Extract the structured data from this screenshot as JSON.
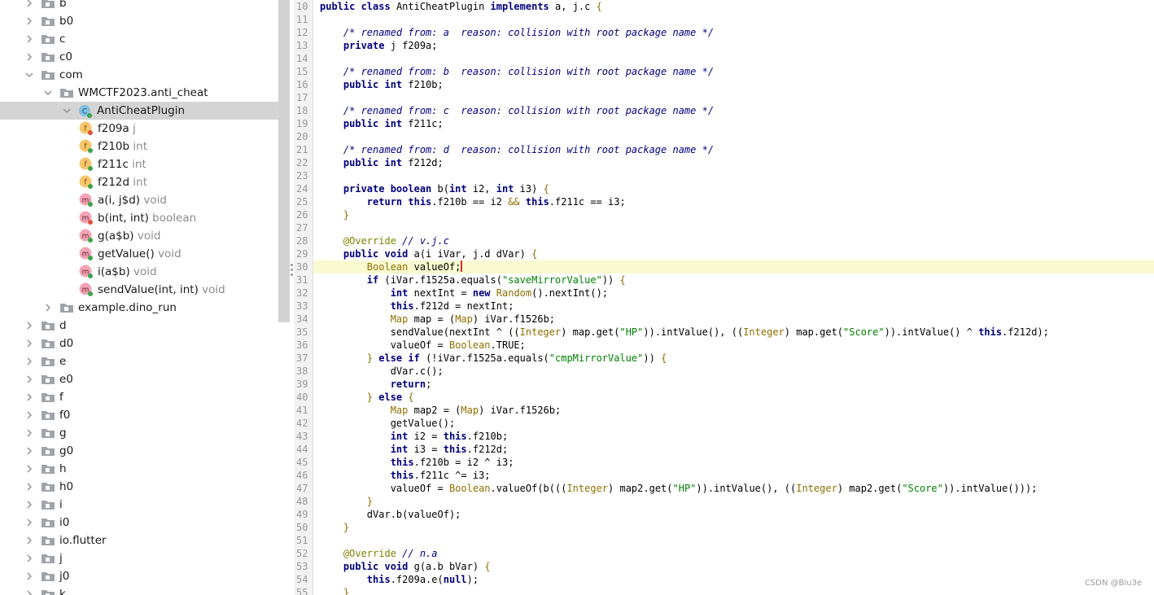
{
  "tree": {
    "rows": [
      {
        "label": "b",
        "type": "",
        "kind": "package",
        "expanded": false,
        "depth": 0
      },
      {
        "label": "b0",
        "type": "",
        "kind": "package",
        "expanded": false,
        "depth": 0
      },
      {
        "label": "c",
        "type": "",
        "kind": "package",
        "expanded": false,
        "depth": 0
      },
      {
        "label": "c0",
        "type": "",
        "kind": "package",
        "expanded": false,
        "depth": 0
      },
      {
        "label": "com",
        "type": "",
        "kind": "package",
        "expanded": true,
        "depth": 0
      },
      {
        "label": "WMCTF2023.anti_cheat",
        "type": "",
        "kind": "package",
        "expanded": true,
        "depth": 1
      },
      {
        "label": "AntiCheatPlugin",
        "type": "",
        "kind": "class",
        "expanded": true,
        "depth": 2,
        "selected": true
      },
      {
        "label": "f209a",
        "type": "j",
        "kind": "field-private",
        "depth": 3
      },
      {
        "label": "f210b",
        "type": "int",
        "kind": "field-public",
        "depth": 3
      },
      {
        "label": "f211c",
        "type": "int",
        "kind": "field-public",
        "depth": 3
      },
      {
        "label": "f212d",
        "type": "int",
        "kind": "field-public",
        "depth": 3
      },
      {
        "label": "a(i, j$d)",
        "type": "void",
        "kind": "method-public",
        "depth": 3
      },
      {
        "label": "b(int, int)",
        "type": "boolean",
        "kind": "method-private",
        "depth": 3
      },
      {
        "label": "g(a$b)",
        "type": "void",
        "kind": "method-public",
        "depth": 3
      },
      {
        "label": "getValue()",
        "type": "void",
        "kind": "method-public-native",
        "depth": 3
      },
      {
        "label": "i(a$b)",
        "type": "void",
        "kind": "method-public",
        "depth": 3
      },
      {
        "label": "sendValue(int, int)",
        "type": "void",
        "kind": "method-public-native",
        "depth": 3
      },
      {
        "label": "example.dino_run",
        "type": "",
        "kind": "package",
        "expanded": false,
        "depth": 1
      },
      {
        "label": "d",
        "type": "",
        "kind": "package",
        "expanded": false,
        "depth": 0
      },
      {
        "label": "d0",
        "type": "",
        "kind": "package",
        "expanded": false,
        "depth": 0
      },
      {
        "label": "e",
        "type": "",
        "kind": "package",
        "expanded": false,
        "depth": 0
      },
      {
        "label": "e0",
        "type": "",
        "kind": "package",
        "expanded": false,
        "depth": 0
      },
      {
        "label": "f",
        "type": "",
        "kind": "package",
        "expanded": false,
        "depth": 0
      },
      {
        "label": "f0",
        "type": "",
        "kind": "package",
        "expanded": false,
        "depth": 0
      },
      {
        "label": "g",
        "type": "",
        "kind": "package",
        "expanded": false,
        "depth": 0
      },
      {
        "label": "g0",
        "type": "",
        "kind": "package",
        "expanded": false,
        "depth": 0
      },
      {
        "label": "h",
        "type": "",
        "kind": "package",
        "expanded": false,
        "depth": 0
      },
      {
        "label": "h0",
        "type": "",
        "kind": "package",
        "expanded": false,
        "depth": 0
      },
      {
        "label": "i",
        "type": "",
        "kind": "package",
        "expanded": false,
        "depth": 0
      },
      {
        "label": "i0",
        "type": "",
        "kind": "package",
        "expanded": false,
        "depth": 0
      },
      {
        "label": "io.flutter",
        "type": "",
        "kind": "package",
        "expanded": false,
        "depth": 0
      },
      {
        "label": "j",
        "type": "",
        "kind": "package",
        "expanded": false,
        "depth": 0
      },
      {
        "label": "j0",
        "type": "",
        "kind": "package",
        "expanded": false,
        "depth": 0
      },
      {
        "label": "k",
        "type": "",
        "kind": "package",
        "expanded": false,
        "depth": 0
      }
    ]
  },
  "editor": {
    "current_line": 30,
    "lines": [
      {
        "n": "10",
        "tokens": [
          [
            "kw",
            "public "
          ],
          [
            "kw",
            "class "
          ],
          [
            "",
            "AntiCheatPlugin "
          ],
          [
            "kw",
            "implements "
          ],
          [
            "",
            "a, j.c "
          ],
          [
            "ty",
            "{"
          ]
        ]
      },
      {
        "n": "11",
        "tokens": []
      },
      {
        "n": "12",
        "tokens": [
          [
            "",
            "    "
          ],
          [
            "cm",
            "/* renamed from: a  reason: collision with root package name */"
          ]
        ]
      },
      {
        "n": "13",
        "tokens": [
          [
            "",
            "    "
          ],
          [
            "kw",
            "private "
          ],
          [
            "",
            "j f209a;"
          ]
        ]
      },
      {
        "n": "14",
        "tokens": []
      },
      {
        "n": "15",
        "tokens": [
          [
            "",
            "    "
          ],
          [
            "cm",
            "/* renamed from: b  reason: collision with root package name */"
          ]
        ]
      },
      {
        "n": "16",
        "tokens": [
          [
            "",
            "    "
          ],
          [
            "kw",
            "public "
          ],
          [
            "kw",
            "int "
          ],
          [
            "",
            "f210b;"
          ]
        ]
      },
      {
        "n": "17",
        "tokens": []
      },
      {
        "n": "18",
        "tokens": [
          [
            "",
            "    "
          ],
          [
            "cm",
            "/* renamed from: c  reason: collision with root package name */"
          ]
        ]
      },
      {
        "n": "19",
        "tokens": [
          [
            "",
            "    "
          ],
          [
            "kw",
            "public "
          ],
          [
            "kw",
            "int "
          ],
          [
            "",
            "f211c;"
          ]
        ]
      },
      {
        "n": "20",
        "tokens": []
      },
      {
        "n": "21",
        "tokens": [
          [
            "",
            "    "
          ],
          [
            "cm",
            "/* renamed from: d  reason: collision with root package name */"
          ]
        ]
      },
      {
        "n": "22",
        "tokens": [
          [
            "",
            "    "
          ],
          [
            "kw",
            "public "
          ],
          [
            "kw",
            "int "
          ],
          [
            "",
            "f212d;"
          ]
        ]
      },
      {
        "n": "23",
        "tokens": []
      },
      {
        "n": "24",
        "tokens": [
          [
            "",
            "    "
          ],
          [
            "kw",
            "private "
          ],
          [
            "kw",
            "boolean "
          ],
          [
            "",
            "b("
          ],
          [
            "kw",
            "int "
          ],
          [
            "",
            "i2, "
          ],
          [
            "kw",
            "int "
          ],
          [
            "",
            "i3) "
          ],
          [
            "ty",
            "{"
          ]
        ]
      },
      {
        "n": "25",
        "tokens": [
          [
            "",
            "        "
          ],
          [
            "kw",
            "return "
          ],
          [
            "kw",
            "this"
          ],
          [
            ".f210b == i2 "
          ],
          [
            "ty",
            "&&"
          ],
          [
            "",
            " "
          ],
          [
            "kw",
            "this"
          ],
          [
            "",
            ".f211c == i3;"
          ]
        ]
      },
      {
        "n": "26",
        "tokens": [
          [
            "",
            "    "
          ],
          [
            "ty",
            "}"
          ]
        ]
      },
      {
        "n": "27",
        "tokens": []
      },
      {
        "n": "28",
        "tokens": [
          [
            "",
            "    "
          ],
          [
            "an",
            "@Override "
          ],
          [
            "cm",
            "// v.j.c"
          ]
        ]
      },
      {
        "n": "29",
        "tokens": [
          [
            "",
            "    "
          ],
          [
            "kw",
            "public "
          ],
          [
            "kw",
            "void "
          ],
          [
            "",
            "a(i iVar, j.d dVar) "
          ],
          [
            "ty",
            "{"
          ]
        ]
      },
      {
        "n": "30",
        "tokens": [
          [
            "",
            "        "
          ],
          [
            "ty",
            "Boolean "
          ],
          [
            "",
            "valueOf;"
          ],
          [
            "caret",
            ""
          ]
        ]
      },
      {
        "n": "31",
        "tokens": [
          [
            "",
            "        "
          ],
          [
            "kw",
            "if "
          ],
          [
            "",
            "(iVar.f1525a.equals("
          ],
          [
            "st",
            "\"saveMirrorValue\""
          ],
          [
            "",
            "))"
          ],
          [
            "",
            " "
          ],
          [
            "ty",
            "{"
          ]
        ]
      },
      {
        "n": "32",
        "tokens": [
          [
            "",
            "            "
          ],
          [
            "kw",
            "int "
          ],
          [
            "",
            "nextInt = "
          ],
          [
            "kw",
            "new "
          ],
          [
            "ty",
            "Random"
          ],
          [
            "",
            "().nextInt();"
          ]
        ]
      },
      {
        "n": "33",
        "tokens": [
          [
            "",
            "            "
          ],
          [
            "kw",
            "this"
          ],
          [
            "",
            ".f212d = nextInt;"
          ]
        ]
      },
      {
        "n": "34",
        "tokens": [
          [
            "",
            "            "
          ],
          [
            "ty",
            "Map "
          ],
          [
            "",
            "map = ("
          ],
          [
            "ty",
            "Map"
          ],
          [
            "",
            ") iVar.f1526b;"
          ]
        ]
      },
      {
        "n": "35",
        "tokens": [
          [
            "",
            "            sendValue(nextInt ^ (("
          ],
          [
            "ty",
            "Integer"
          ],
          [
            "",
            ") map.get("
          ],
          [
            "st",
            "\"HP\""
          ],
          [
            "",
            ")).intValue(), (("
          ],
          [
            "ty",
            "Integer"
          ],
          [
            "",
            ") map.get("
          ],
          [
            "st",
            "\"Score\""
          ],
          [
            "",
            ")).intValue() ^ "
          ],
          [
            "kw",
            "this"
          ],
          [
            "",
            ".f212d);"
          ]
        ]
      },
      {
        "n": "36",
        "tokens": [
          [
            "",
            "            valueOf = "
          ],
          [
            "ty",
            "Boolean"
          ],
          [
            "",
            ".TRUE;"
          ]
        ]
      },
      {
        "n": "37",
        "tokens": [
          [
            "",
            "        "
          ],
          [
            "ty",
            "} "
          ],
          [
            "kw",
            "else "
          ],
          [
            "kw",
            "if "
          ],
          [
            "",
            "(!iVar.f1525a.equals("
          ],
          [
            "st",
            "\"cmpMirrorValue\""
          ],
          [
            "",
            "))"
          ],
          [
            "",
            " "
          ],
          [
            "ty",
            "{"
          ]
        ]
      },
      {
        "n": "38",
        "tokens": [
          [
            "",
            "            dVar.c();"
          ]
        ]
      },
      {
        "n": "39",
        "tokens": [
          [
            "",
            "            "
          ],
          [
            "kw",
            "return"
          ],
          [
            "",
            ";"
          ]
        ]
      },
      {
        "n": "40",
        "tokens": [
          [
            "",
            "        "
          ],
          [
            "ty",
            "} "
          ],
          [
            "kw",
            "else "
          ],
          [
            "ty",
            "{"
          ]
        ]
      },
      {
        "n": "41",
        "tokens": [
          [
            "",
            "            "
          ],
          [
            "ty",
            "Map "
          ],
          [
            "",
            "map2 = ("
          ],
          [
            "ty",
            "Map"
          ],
          [
            "",
            ") iVar.f1526b;"
          ]
        ]
      },
      {
        "n": "42",
        "tokens": [
          [
            "",
            "            getValue();"
          ]
        ]
      },
      {
        "n": "43",
        "tokens": [
          [
            "",
            "            "
          ],
          [
            "kw",
            "int "
          ],
          [
            "",
            "i2 = "
          ],
          [
            "kw",
            "this"
          ],
          [
            "",
            ".f210b;"
          ]
        ]
      },
      {
        "n": "44",
        "tokens": [
          [
            "",
            "            "
          ],
          [
            "kw",
            "int "
          ],
          [
            "",
            "i3 = "
          ],
          [
            "kw",
            "this"
          ],
          [
            "",
            ".f212d;"
          ]
        ]
      },
      {
        "n": "45",
        "tokens": [
          [
            "",
            "            "
          ],
          [
            "kw",
            "this"
          ],
          [
            "",
            ".f210b = i2 ^ i3;"
          ]
        ]
      },
      {
        "n": "46",
        "tokens": [
          [
            "",
            "            "
          ],
          [
            "kw",
            "this"
          ],
          [
            "",
            ".f211c ^= i3;"
          ]
        ]
      },
      {
        "n": "47",
        "tokens": [
          [
            "",
            "            valueOf = "
          ],
          [
            "ty",
            "Boolean"
          ],
          [
            "",
            ".valueOf(b((("
          ],
          [
            "ty",
            "Integer"
          ],
          [
            "",
            ") map2.get("
          ],
          [
            "st",
            "\"HP\""
          ],
          [
            "",
            ")).intValue(), (("
          ],
          [
            "ty",
            "Integer"
          ],
          [
            "",
            ") map2.get("
          ],
          [
            "st",
            "\"Score\""
          ],
          [
            "",
            ")).intValue()));"
          ]
        ]
      },
      {
        "n": "48",
        "tokens": [
          [
            "",
            "        "
          ],
          [
            "ty",
            "}"
          ]
        ]
      },
      {
        "n": "49",
        "tokens": [
          [
            "",
            "        dVar.b(valueOf);"
          ]
        ]
      },
      {
        "n": "50",
        "tokens": [
          [
            "",
            "    "
          ],
          [
            "ty",
            "}"
          ]
        ]
      },
      {
        "n": "51",
        "tokens": []
      },
      {
        "n": "52",
        "tokens": [
          [
            "",
            "    "
          ],
          [
            "an",
            "@Override "
          ],
          [
            "cm",
            "// n.a"
          ]
        ]
      },
      {
        "n": "53",
        "tokens": [
          [
            "",
            "    "
          ],
          [
            "kw",
            "public "
          ],
          [
            "kw",
            "void "
          ],
          [
            "",
            "g(a.b bVar) "
          ],
          [
            "ty",
            "{"
          ]
        ]
      },
      {
        "n": "54",
        "tokens": [
          [
            "",
            "        "
          ],
          [
            "kw",
            "this"
          ],
          [
            "",
            ".f209a.e("
          ],
          [
            "kw",
            "null"
          ],
          [
            "",
            ");"
          ]
        ]
      },
      {
        "n": "55",
        "tokens": [
          [
            "",
            "    "
          ],
          [
            "ty",
            "}"
          ]
        ]
      }
    ]
  },
  "watermark": "CSDN @Blu3e",
  "colors": {
    "keyword": "#000080",
    "string": "#008000",
    "type": "#8f6e00",
    "annotation": "#808000",
    "current_line": "#fafad0",
    "selection": "#d4d4d4"
  }
}
